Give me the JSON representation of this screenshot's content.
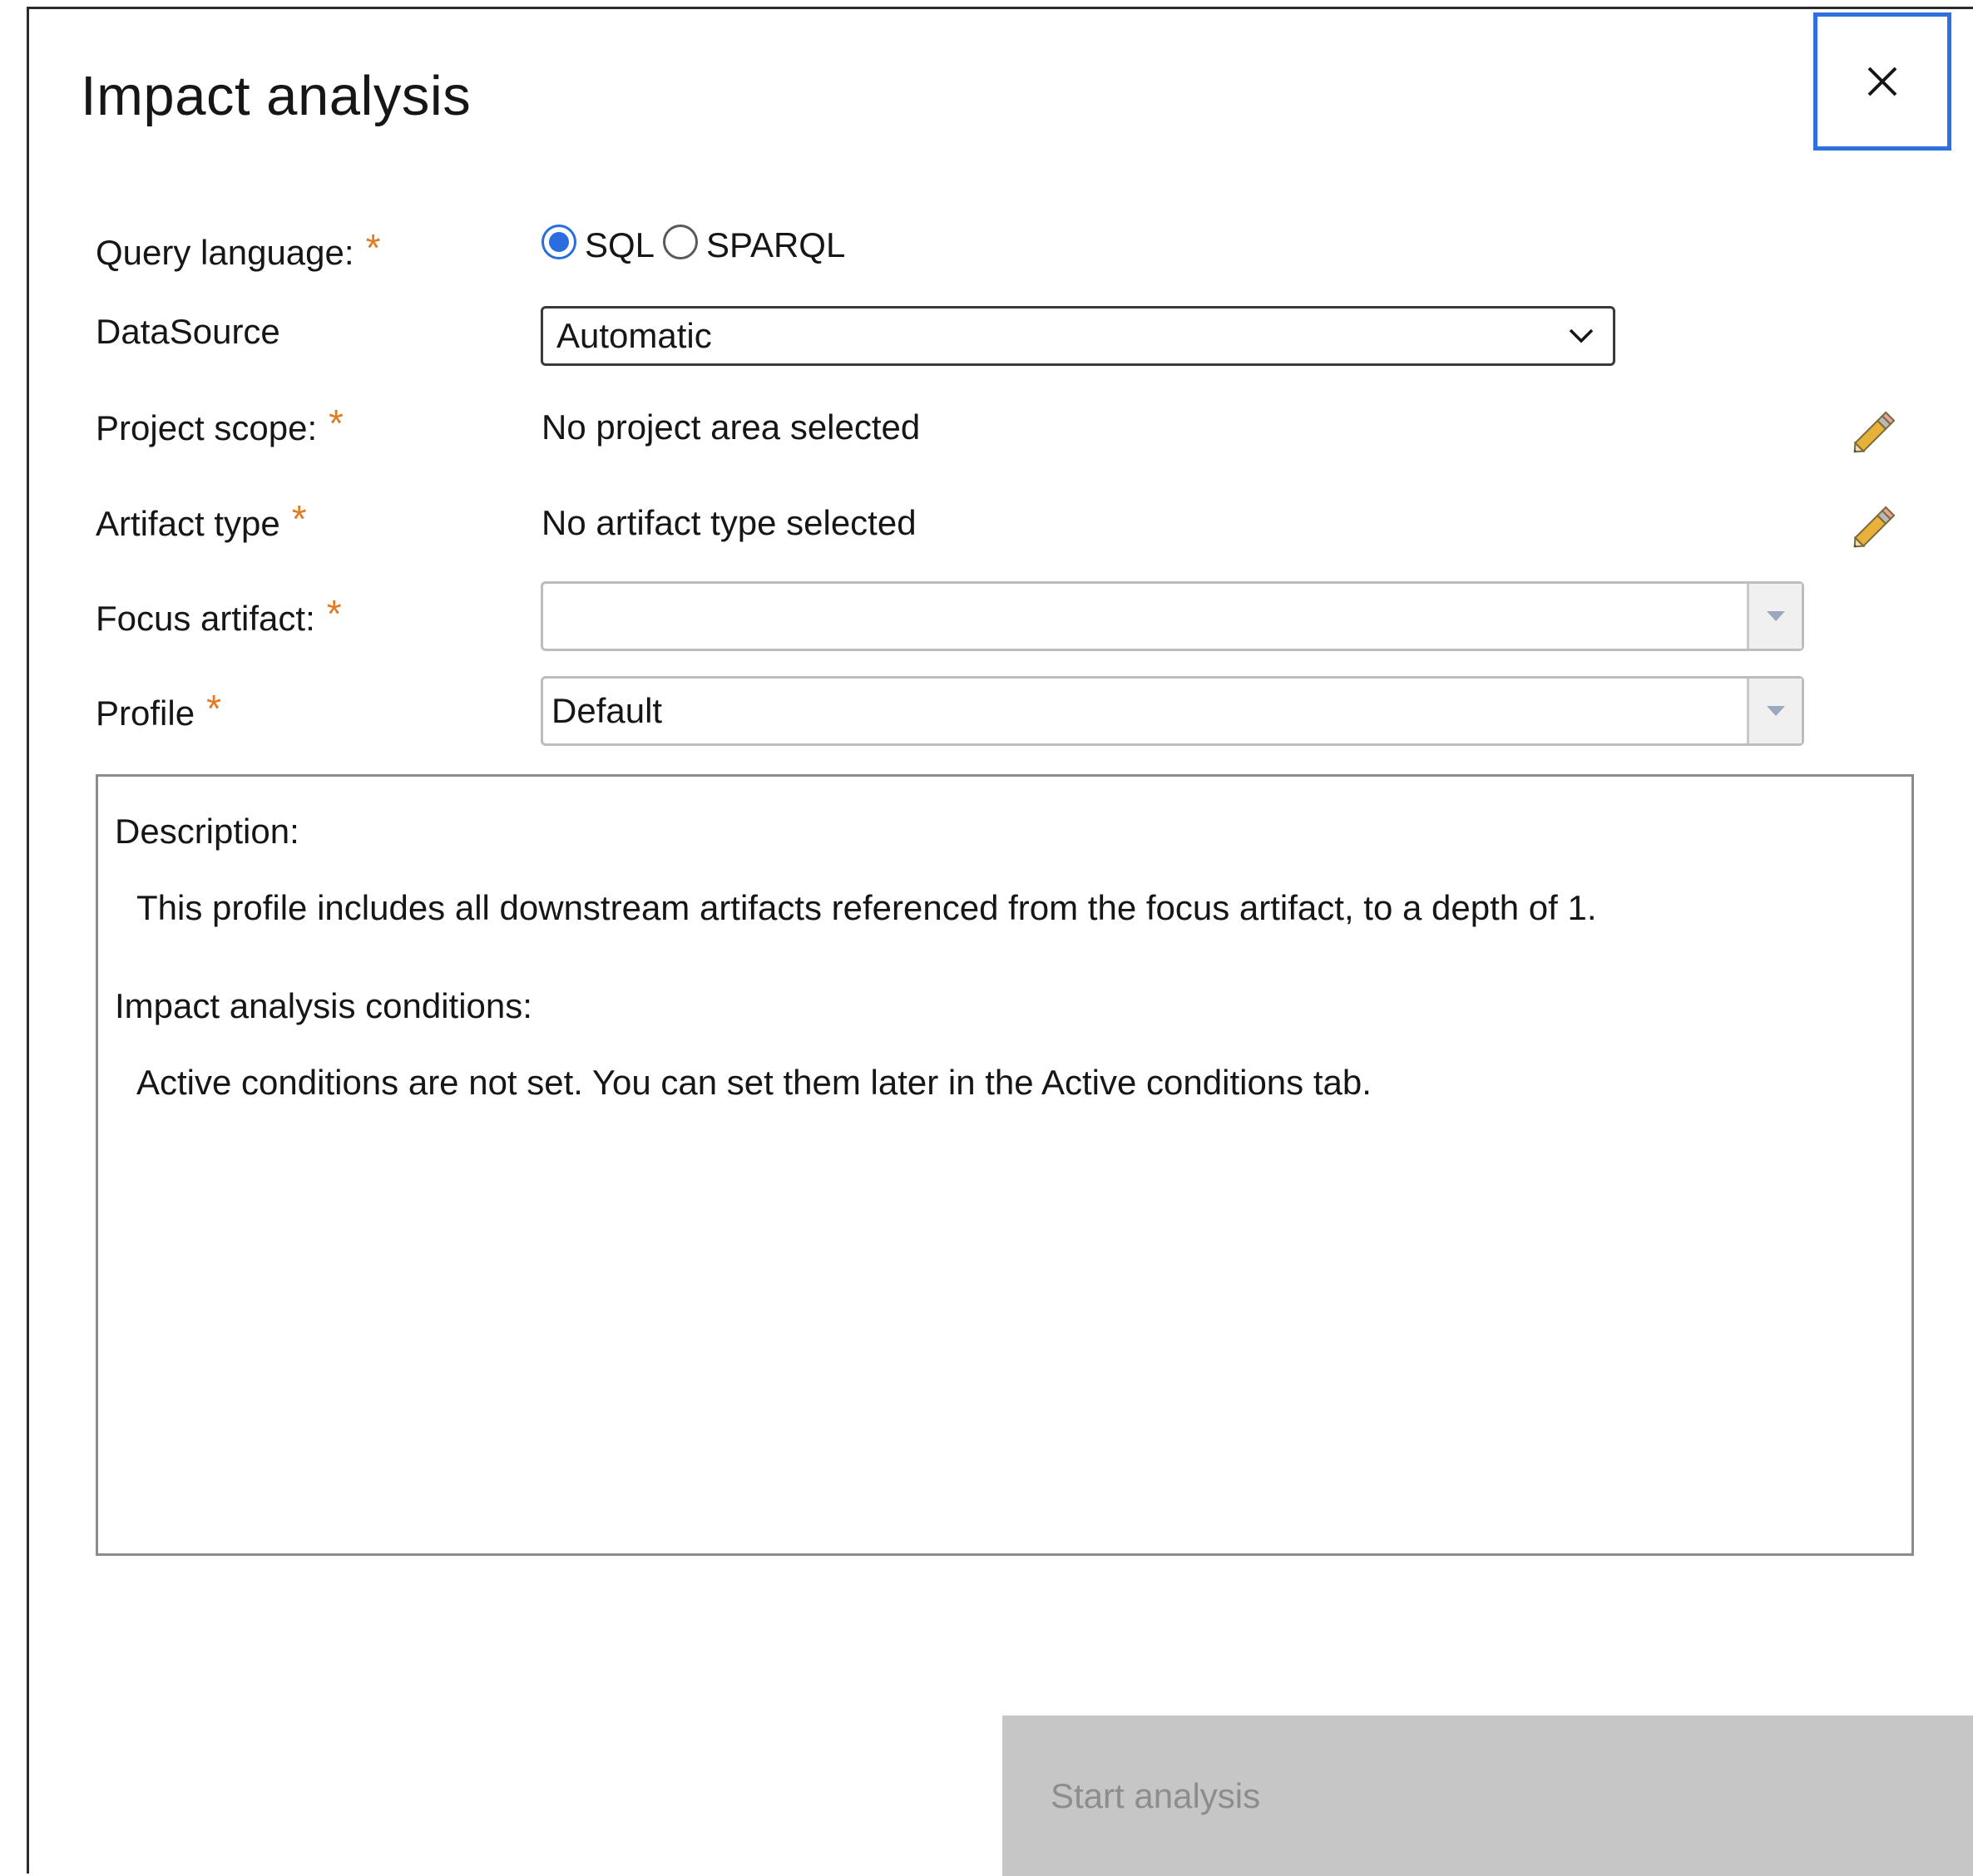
{
  "dialog": {
    "title": "Impact analysis",
    "close_icon": "close-icon"
  },
  "form": {
    "query_language": {
      "label": "Query language:",
      "required": "*",
      "options": [
        {
          "label": "SQL",
          "selected": true
        },
        {
          "label": "SPARQL",
          "selected": false
        }
      ]
    },
    "datasource": {
      "label": "DataSource",
      "value": "Automatic"
    },
    "project_scope": {
      "label": "Project scope:",
      "required": "*",
      "value": "No project area selected",
      "edit_icon": "pencil-icon"
    },
    "artifact_type": {
      "label": "Artifact type",
      "required": "*",
      "value": "No artifact type selected",
      "edit_icon": "pencil-icon"
    },
    "focus_artifact": {
      "label": "Focus artifact:",
      "required": "*",
      "value": ""
    },
    "profile": {
      "label": "Profile",
      "required": "*",
      "value": "Default"
    }
  },
  "description": {
    "heading": "Description:",
    "text": "This profile includes all downstream artifacts referenced from the focus artifact, to a depth of 1.",
    "conditions_heading": "Impact analysis conditions:",
    "conditions_text": "Active conditions are not set. You can set them later in the Active conditions tab."
  },
  "footer": {
    "start_label": "Start analysis"
  },
  "colors": {
    "accent": "#2b6de0",
    "required": "#e07b26",
    "disabled_button_bg": "#c6c6c6",
    "disabled_button_text": "#8d8d8d"
  }
}
